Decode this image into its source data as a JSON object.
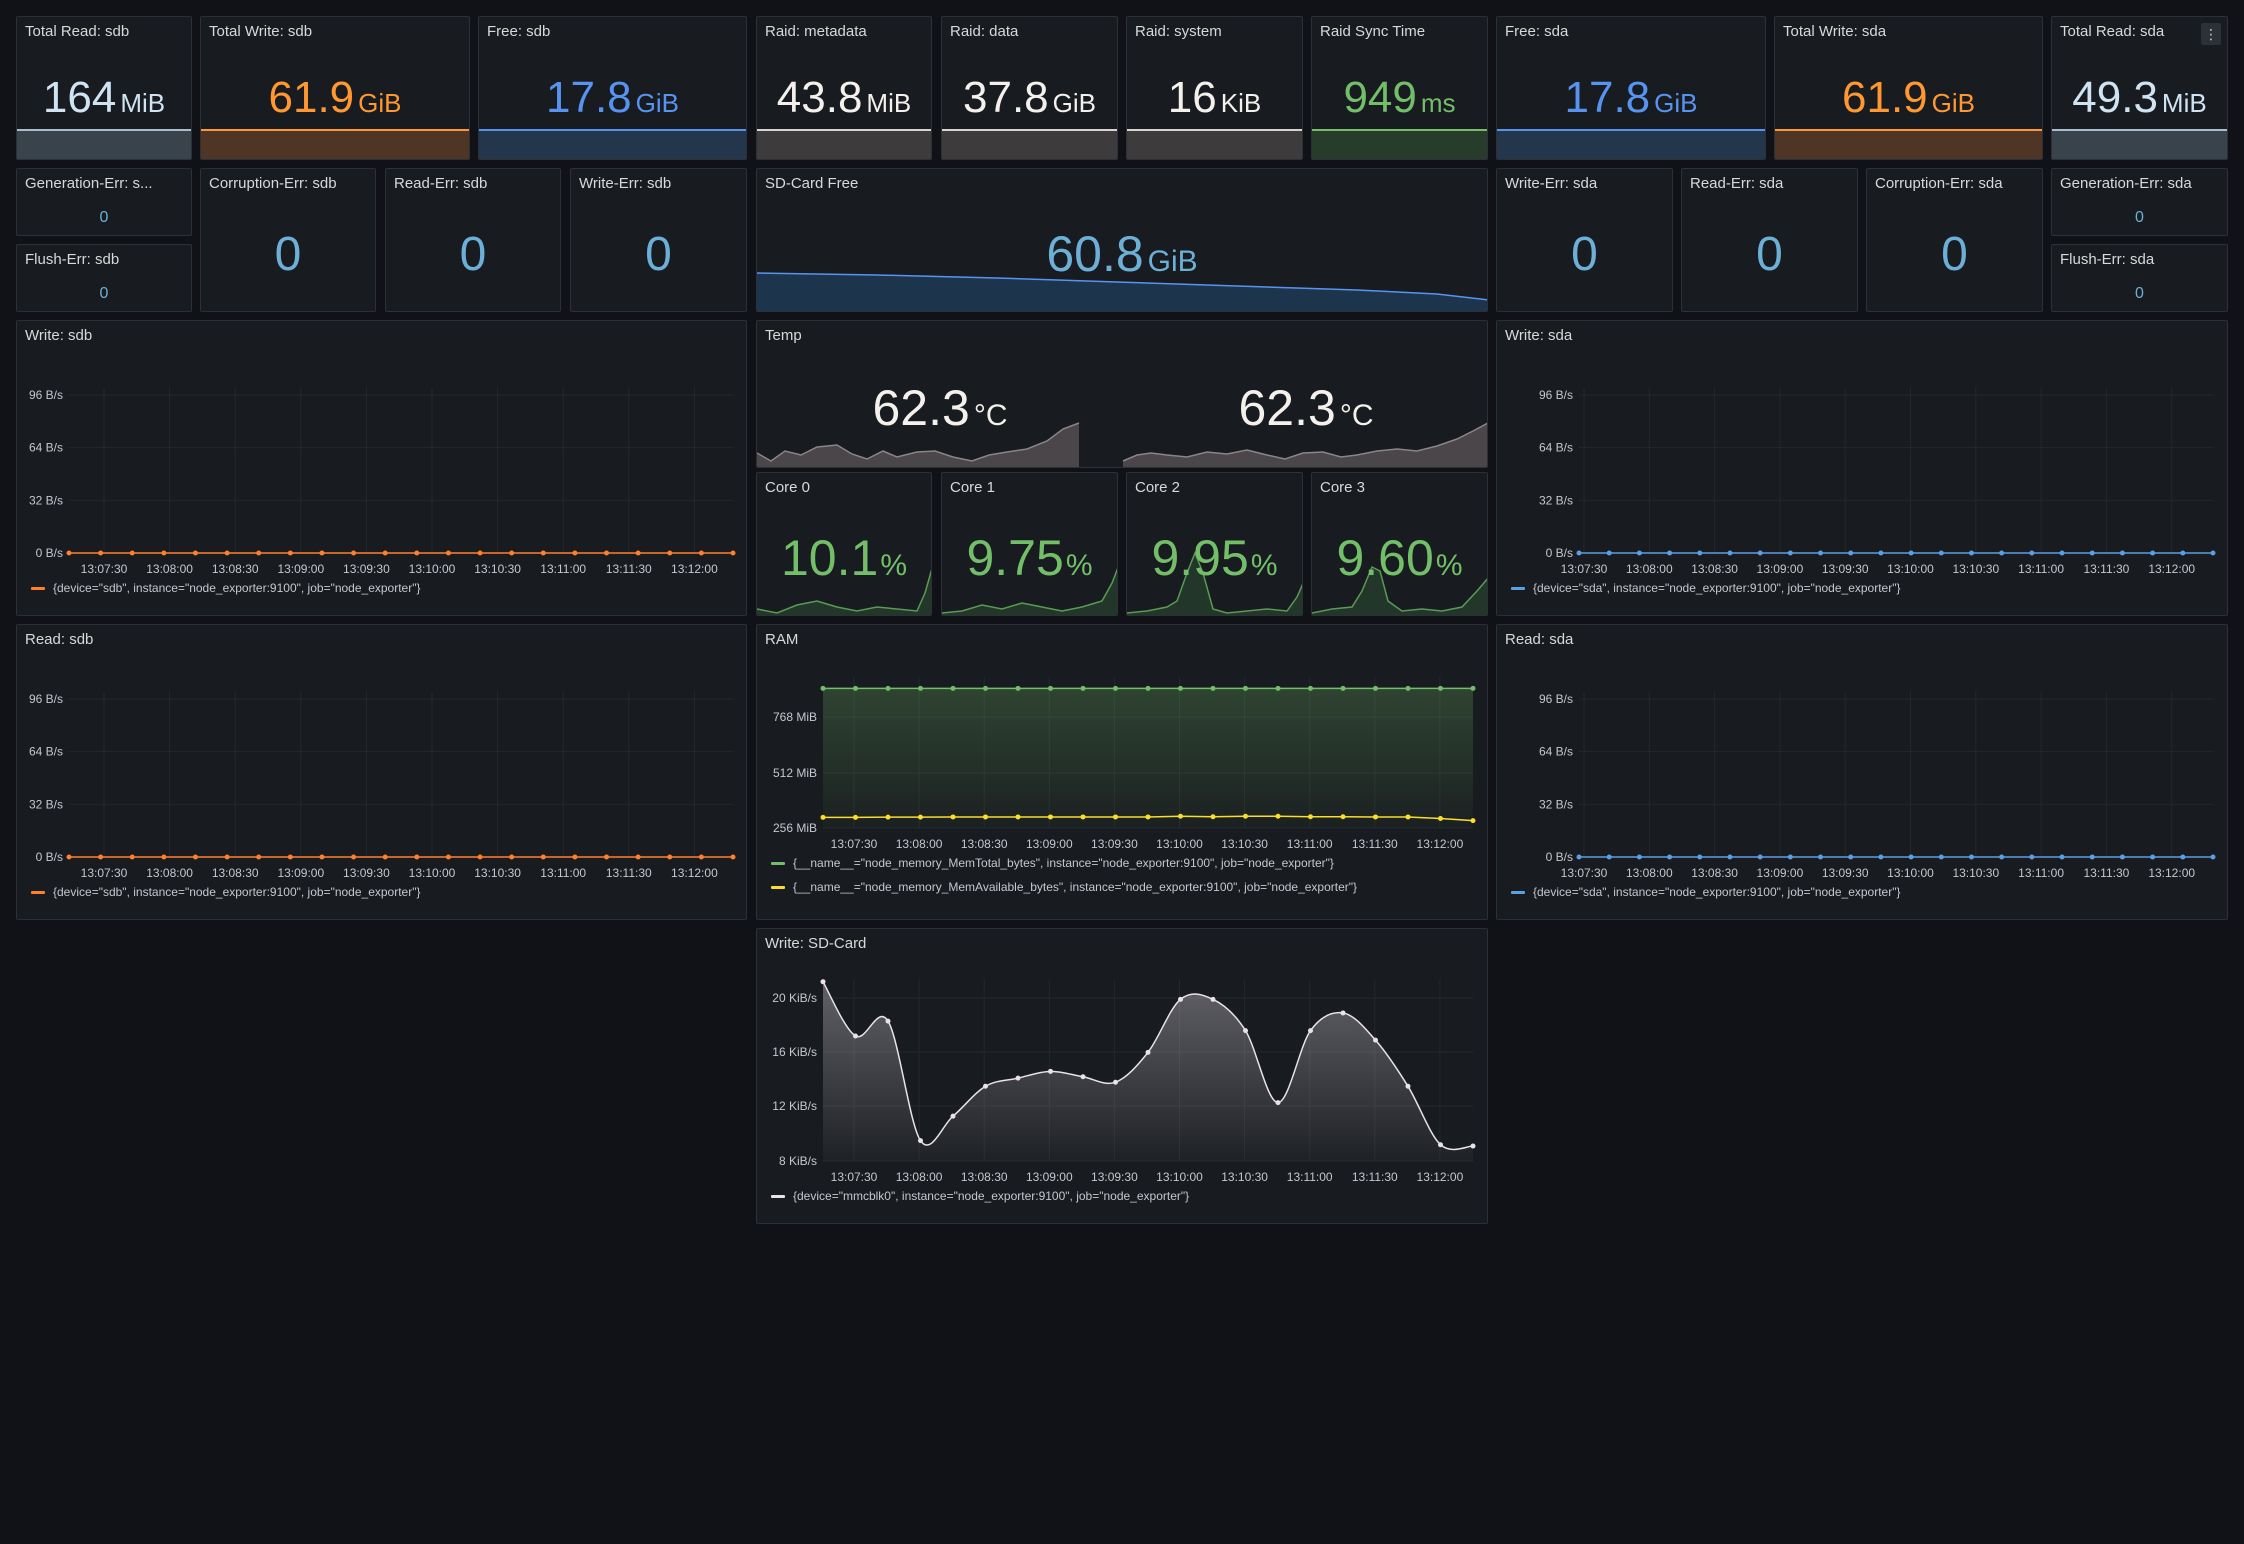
{
  "row1": [
    {
      "title": "Total Read: sdb",
      "value": "164",
      "unit": "MiB",
      "color": "#cfe3f2",
      "band": "#39434b",
      "line": "#aabed0"
    },
    {
      "title": "Total Write: sdb",
      "value": "61.9",
      "unit": "GiB",
      "color": "#ff9830",
      "band": "#4f3525",
      "line": "#ff9830"
    },
    {
      "title": "Free: sdb",
      "value": "17.8",
      "unit": "GiB",
      "color": "#5794f2",
      "band": "#24364b",
      "line": "#5794f2"
    },
    {
      "title": "Raid: metadata",
      "value": "43.8",
      "unit": "MiB",
      "color": "#f4f0ec",
      "band": "#3e3b3d",
      "line": "#d8d4d0"
    },
    {
      "title": "Raid: data",
      "value": "37.8",
      "unit": "GiB",
      "color": "#f4f0ec",
      "band": "#3e3b3d",
      "line": "#d8d4d0"
    },
    {
      "title": "Raid: system",
      "value": "16",
      "unit": "KiB",
      "color": "#f4f0ec",
      "band": "#3e3b3d",
      "line": "#d8d4d0"
    },
    {
      "title": "Raid Sync Time",
      "value": "949",
      "unit": "ms",
      "color": "#73bf69",
      "band": "#283c2c",
      "line": "#73bf69"
    },
    {
      "title": "Free: sda",
      "value": "17.8",
      "unit": "GiB",
      "color": "#5794f2",
      "band": "#24364b",
      "line": "#5794f2"
    },
    {
      "title": "Total Write: sda",
      "value": "61.9",
      "unit": "GiB",
      "color": "#ff9830",
      "band": "#4f3525",
      "line": "#ff9830"
    },
    {
      "title": "Total Read: sda",
      "value": "49.3",
      "unit": "MiB",
      "color": "#cfe3f2",
      "band": "#39434b",
      "line": "#aabed0"
    }
  ],
  "errors_sdb": {
    "generation": {
      "title": "Generation-Err: s...",
      "value": "0"
    },
    "flush": {
      "title": "Flush-Err: sdb",
      "value": "0"
    },
    "corruption": {
      "title": "Corruption-Err: sdb",
      "value": "0"
    },
    "read": {
      "title": "Read-Err: sdb",
      "value": "0"
    },
    "write": {
      "title": "Write-Err: sdb",
      "value": "0"
    }
  },
  "errors_sda": {
    "write": {
      "title": "Write-Err: sda",
      "value": "0"
    },
    "read": {
      "title": "Read-Err: sda",
      "value": "0"
    },
    "corruption": {
      "title": "Corruption-Err: sda",
      "value": "0"
    },
    "generation": {
      "title": "Generation-Err: sda",
      "value": "0"
    },
    "flush": {
      "title": "Flush-Err: sda",
      "value": "0"
    }
  },
  "sdcard_free": {
    "title": "SD-Card Free",
    "value": "60.8",
    "unit": "GiB"
  },
  "temp": {
    "title": "Temp",
    "values": [
      {
        "value": "62.3",
        "unit": "°C"
      },
      {
        "value": "62.3",
        "unit": "°C"
      }
    ]
  },
  "cores": [
    {
      "title": "Core 0",
      "value": "10.1",
      "unit": "%"
    },
    {
      "title": "Core 1",
      "value": "9.75",
      "unit": "%"
    },
    {
      "title": "Core 2",
      "value": "9.95",
      "unit": "%"
    },
    {
      "title": "Core 3",
      "value": "9.60",
      "unit": "%"
    }
  ],
  "menu_icon": "⋮",
  "chart_data": [
    {
      "id": "write_sdb",
      "type": "line",
      "title": "Write: sdb",
      "x": [
        "13:07:30",
        "13:08:00",
        "13:08:30",
        "13:09:00",
        "13:09:30",
        "13:10:00",
        "13:10:30",
        "13:11:00",
        "13:11:30",
        "13:12:00"
      ],
      "y_ticks": [
        "96 B/s",
        "64 B/s",
        "32 B/s",
        "0 B/s"
      ],
      "ylim": [
        0,
        96
      ],
      "series": [
        {
          "name": "{device=\"sdb\", instance=\"node_exporter:9100\", job=\"node_exporter\"}",
          "color": "#ff7f2a",
          "values": [
            0,
            0,
            0,
            0,
            0,
            0,
            0,
            0,
            0,
            0,
            0,
            0,
            0,
            0,
            0,
            0,
            0,
            0,
            0,
            0,
            0,
            0
          ]
        }
      ]
    },
    {
      "id": "read_sdb",
      "type": "line",
      "title": "Read: sdb",
      "x": [
        "13:07:30",
        "13:08:00",
        "13:08:30",
        "13:09:00",
        "13:09:30",
        "13:10:00",
        "13:10:30",
        "13:11:00",
        "13:11:30",
        "13:12:00"
      ],
      "y_ticks": [
        "96 B/s",
        "64 B/s",
        "32 B/s",
        "0 B/s"
      ],
      "ylim": [
        0,
        96
      ],
      "series": [
        {
          "name": "{device=\"sdb\", instance=\"node_exporter:9100\", job=\"node_exporter\"}",
          "color": "#ff7f2a",
          "values": [
            0,
            0,
            0,
            0,
            0,
            0,
            0,
            0,
            0,
            0,
            0,
            0,
            0,
            0,
            0,
            0,
            0,
            0,
            0,
            0,
            0,
            0
          ]
        }
      ]
    },
    {
      "id": "write_sda",
      "type": "line",
      "title": "Write: sda",
      "x": [
        "13:07:30",
        "13:08:00",
        "13:08:30",
        "13:09:00",
        "13:09:30",
        "13:10:00",
        "13:10:30",
        "13:11:00",
        "13:11:30",
        "13:12:00"
      ],
      "y_ticks": [
        "96 B/s",
        "64 B/s",
        "32 B/s",
        "0 B/s"
      ],
      "ylim": [
        0,
        96
      ],
      "series": [
        {
          "name": "{device=\"sda\", instance=\"node_exporter:9100\", job=\"node_exporter\"}",
          "color": "#5aa0e0",
          "values": [
            0,
            0,
            0,
            0,
            0,
            0,
            0,
            0,
            0,
            0,
            0,
            0,
            0,
            0,
            0,
            0,
            0,
            0,
            0,
            0,
            0,
            0
          ]
        }
      ]
    },
    {
      "id": "read_sda",
      "type": "line",
      "title": "Read: sda",
      "x": [
        "13:07:30",
        "13:08:00",
        "13:08:30",
        "13:09:00",
        "13:09:30",
        "13:10:00",
        "13:10:30",
        "13:11:00",
        "13:11:30",
        "13:12:00"
      ],
      "y_ticks": [
        "96 B/s",
        "64 B/s",
        "32 B/s",
        "0 B/s"
      ],
      "ylim": [
        0,
        96
      ],
      "series": [
        {
          "name": "{device=\"sda\", instance=\"node_exporter:9100\", job=\"node_exporter\"}",
          "color": "#5aa0e0",
          "values": [
            0,
            0,
            0,
            0,
            0,
            0,
            0,
            0,
            0,
            0,
            0,
            0,
            0,
            0,
            0,
            0,
            0,
            0,
            0,
            0,
            0,
            0
          ]
        }
      ]
    },
    {
      "id": "ram",
      "type": "area",
      "title": "RAM",
      "x": [
        "13:07:30",
        "13:08:00",
        "13:08:30",
        "13:09:00",
        "13:09:30",
        "13:10:00",
        "13:10:30",
        "13:11:00",
        "13:11:30",
        "13:12:00"
      ],
      "y_ticks": [
        "768 MiB",
        "512 MiB",
        "256 MiB"
      ],
      "ylim": [
        256,
        768
      ],
      "series": [
        {
          "name": "{__name__=\"node_memory_MemTotal_bytes\", instance=\"node_exporter:9100\", job=\"node_exporter\"}",
          "color": "#73bf69",
          "values": [
            900,
            900,
            900,
            900,
            900,
            900,
            900,
            900,
            900,
            900,
            900,
            900,
            900,
            900,
            900,
            900,
            900,
            900,
            900,
            900,
            900
          ]
        },
        {
          "name": "{__name__=\"node_memory_MemAvailable_bytes\", instance=\"node_exporter:9100\", job=\"node_exporter\"}",
          "color": "#fade2a",
          "values": [
            305,
            305,
            306,
            306,
            307,
            307,
            307,
            307,
            307,
            307,
            307,
            310,
            308,
            310,
            310,
            308,
            308,
            307,
            307,
            300,
            290
          ]
        }
      ]
    },
    {
      "id": "write_sdcard",
      "type": "area",
      "title": "Write: SD-Card",
      "x": [
        "13:07:30",
        "13:08:00",
        "13:08:30",
        "13:09:00",
        "13:09:30",
        "13:10:00",
        "13:10:30",
        "13:11:00",
        "13:11:30",
        "13:12:00"
      ],
      "y_ticks": [
        "20 KiB/s",
        "16 KiB/s",
        "12 KiB/s",
        "8 KiB/s"
      ],
      "ylim": [
        8,
        20
      ],
      "series": [
        {
          "name": "{device=\"mmcblk0\", instance=\"node_exporter:9100\", job=\"node_exporter\"}",
          "color": "#e8e2ea",
          "values": [
            21.2,
            17.2,
            18.3,
            9.5,
            11.3,
            13.5,
            14.1,
            14.6,
            14.2,
            13.8,
            16,
            19.9,
            19.9,
            17.6,
            12.3,
            17.6,
            18.9,
            16.9,
            13.5,
            9.2,
            9.1
          ]
        }
      ]
    }
  ]
}
